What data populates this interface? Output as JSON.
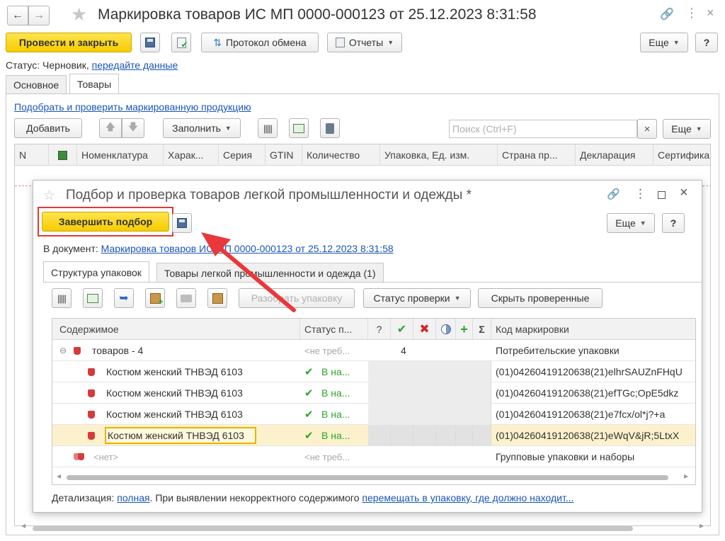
{
  "window": {
    "title": "Маркировка товаров ИС МП 0000-000123 от 25.12.2023 8:31:58",
    "post_close": "Провести и закрыть",
    "exchange_protocol": "Протокол обмена",
    "reports": "Отчеты",
    "more": "Еще",
    "help": "?",
    "status_label": "Статус:",
    "status_value": "Черновик,",
    "status_link": "передайте данные",
    "tabs": [
      "Основное",
      "Товары"
    ]
  },
  "goods": {
    "pick_link": "Подобрать и проверить маркированную продукцию",
    "add": "Добавить",
    "fill": "Заполнить",
    "search_placeholder": "Поиск (Ctrl+F)",
    "more": "Еще",
    "columns": [
      "N",
      "Номенклатура",
      "Харак...",
      "Серия",
      "GTIN",
      "Количество",
      "Упаковка, Ед. изм.",
      "Страна пр...",
      "Декларация",
      "Сертифика"
    ]
  },
  "dialog": {
    "title": "Подбор и проверка товаров легкой промышленности и одежды *",
    "finish": "Завершить подбор",
    "more": "Еще",
    "help": "?",
    "doc_label": "В документ:",
    "doc_link": "Маркировка товаров ИС МП 0000-000123 от 25.12.2023 8:31:58",
    "tabs": [
      "Структура упаковок",
      "Товары легкой промышленности и одежда (1)"
    ],
    "unpack": "Разобрать упаковку",
    "check_status": "Статус проверки",
    "hide_checked": "Скрыть проверенные",
    "columns": [
      "Содержимое",
      "Статус п...",
      "?",
      "Σ",
      "Код маркировки"
    ],
    "rows": [
      {
        "name": "товаров - 4",
        "status": "<не треб...",
        "count": "4",
        "code": "Потребительские упаковки"
      },
      {
        "name": "Костюм женский ТНВЭД 6103",
        "status": "В на...",
        "count": "",
        "code": "(01)04260419120638(21)elhrSAUZnFHqU"
      },
      {
        "name": "Костюм женский ТНВЭД 6103",
        "status": "В на...",
        "count": "",
        "code": "(01)04260419120638(21)efTGc;OpE5dkz"
      },
      {
        "name": "Костюм женский ТНВЭД 6103",
        "status": "В на...",
        "count": "",
        "code": "(01)04260419120638(21)e7fcx/ol*j?+a"
      },
      {
        "name": "Костюм женский ТНВЭД 6103",
        "status": "В на...",
        "count": "",
        "code": "(01)04260419120638(21)eWqV&jR;5LtxX"
      },
      {
        "name": "<нет>",
        "status": "<не треб...",
        "count": "",
        "code": "Групповые упаковки и наборы"
      }
    ],
    "footer_label": "Детализация:",
    "footer_link1": "полная",
    "footer_text": ". При выявлении некорректного содержимого",
    "footer_link2": "перемещать в упаковку, где должно находит..."
  },
  "colors": {
    "accent_yellow": "#f6cc00",
    "link": "#1a56b8",
    "highlight_border": "#e0383a",
    "arrow": "#e8383b"
  }
}
